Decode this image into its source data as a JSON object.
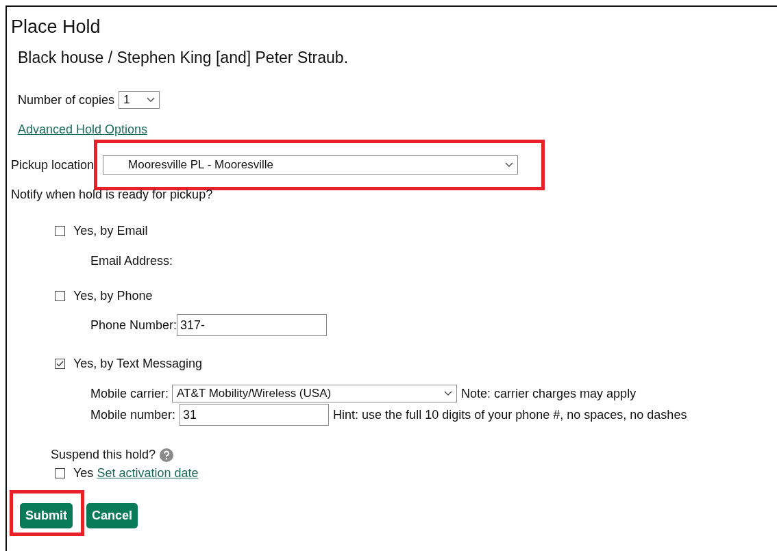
{
  "title": "Place Hold",
  "item_title": "Black house / Stephen King [and] Peter Straub.",
  "copies": {
    "label": "Number of copies",
    "value": "1"
  },
  "advanced_link": "Advanced Hold Options",
  "pickup": {
    "label": "Pickup location",
    "value": "Mooresville PL - Mooresville",
    "highlighted": true
  },
  "notify_question": "Notify when hold is ready for pickup?",
  "notify_options": [
    {
      "kind": "email",
      "label": "Yes, by Email",
      "checked": false,
      "field_label": "Email Address:"
    },
    {
      "kind": "phone",
      "label": "Yes, by Phone",
      "checked": false,
      "field_label": "Phone Number:",
      "value": "317-"
    },
    {
      "kind": "text",
      "label": "Yes, by Text Messaging",
      "checked": true,
      "carrier_label": "Mobile carrier:",
      "carrier": "AT&T Mobility/Wireless (USA)",
      "carrier_note": "Note: carrier charges may apply",
      "number_label": "Mobile number:",
      "value": "31",
      "number_hint": "Hint: use the full 10 digits of your phone #, no spaces, no dashes"
    }
  ],
  "suspend": {
    "question": "Suspend this hold?",
    "checked": false,
    "yes_label": "Yes",
    "link": "Set activation date"
  },
  "buttons": [
    {
      "label": "Submit",
      "highlighted": true
    },
    {
      "label": "Cancel",
      "highlighted": false
    }
  ]
}
